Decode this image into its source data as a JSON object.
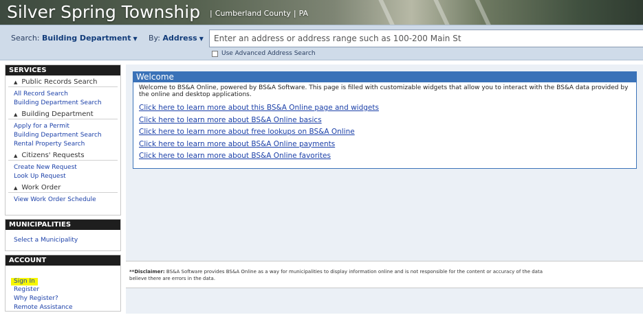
{
  "header": {
    "title": "Silver Spring Township",
    "separator": "|",
    "county": "Cumberland County",
    "state": "PA"
  },
  "search": {
    "search_label": "Search:",
    "search_value": "Building Department",
    "by_label": "By:",
    "by_value": "Address",
    "placeholder": "Enter an address or address range such as 100-200 Main St",
    "advanced_label": "Use Advanced Address Search"
  },
  "sidebar": {
    "services": {
      "heading": "SERVICES",
      "groups": [
        {
          "label": "Public Records Search",
          "links": [
            "All Record Search",
            "Building Department Search"
          ]
        },
        {
          "label": "Building Department",
          "links": [
            "Apply for a Permit",
            "Building Department Search",
            "Rental Property Search"
          ]
        },
        {
          "label": "Citizens' Requests",
          "links": [
            "Create New Request",
            "Look Up Request"
          ]
        },
        {
          "label": "Work Order",
          "links": [
            "View Work Order Schedule"
          ]
        }
      ]
    },
    "municipalities": {
      "heading": "MUNICIPALITIES",
      "links": [
        "Select a Municipality"
      ]
    },
    "account": {
      "heading": "ACCOUNT",
      "links": [
        "Sign In",
        "Register",
        "Why Register?",
        "Remote Assistance"
      ]
    }
  },
  "welcome": {
    "heading": "Welcome",
    "intro": "Welcome to BS&A Online, powered by BS&A Software. This page is filled with customizable widgets that allow you to interact with the BS&A data provided by the online and desktop applications.",
    "links": [
      "Click here to learn more about this BS&A Online page and widgets",
      "Click here to learn more about BS&A Online basics",
      "Click here to learn more about free lookups on BS&A Online",
      "Click here to learn more about BS&A Online payments",
      "Click here to learn more about BS&A Online favorites"
    ]
  },
  "disclaimer": {
    "label": "**Disclaimer:",
    "text": "BS&A Software provides BS&A Online as a way for municipalities to display information online and is not responsible for the content or accuracy of the data",
    "text2": "believe there are errors in the data."
  },
  "colors": {
    "link": "#1a3fa8",
    "panel_head": "#1e1e1e",
    "welcome_head": "#3a72b8",
    "highlight": "#f7f700"
  }
}
